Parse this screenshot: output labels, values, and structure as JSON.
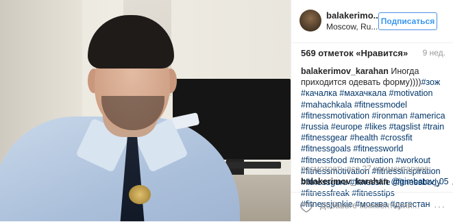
{
  "post": {
    "username": "balakerimo...",
    "location": "Moscow, Ru...",
    "follow_label": "Подписаться",
    "likes": "569 отметок «Нравится»",
    "time": "9 нед.",
    "caption_author": "balakerimov_karahan",
    "caption_text": " Иногда приходится одевать форму))))",
    "caption_tags": "#зож #качалка #махачкала #motivation #mahachkala #fitnessmodel #fitnessmotivation #ironman #america #russia #europe #likes #tagslist #train #fitnessgear #health #crossfit #fitnessgoals #fitnessworld #fitnessfood #motivation #workout #fitnessmotivation #fitnessinspiration #fitnessguru #fitnesslife #fitnessbody #fitnessfreak #fitnesstips #fitnessjunkie #москва #дагестан",
    "view_all_comments": "посмотреть все 27 комментариев",
    "comment_author": "balakerimov_karahan",
    "comment_text": " @gimbatov_05",
    "comment_emoji": " 🙏🙏",
    "add_comment_placeholder": "Добавьте комментарий...",
    "more_label": "···"
  },
  "colors": {
    "link_blue": "#003569",
    "follow_blue": "#3897f0",
    "muted": "#999999"
  },
  "icons": {
    "like": "heart-icon",
    "more": "more-options-icon"
  }
}
